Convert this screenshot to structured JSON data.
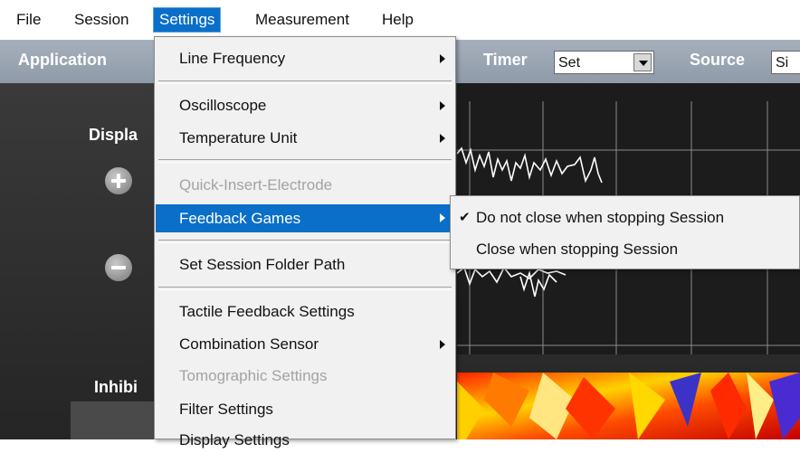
{
  "menubar": {
    "items": [
      {
        "label": "File"
      },
      {
        "label": "Session"
      },
      {
        "label": "Settings"
      },
      {
        "label": "Measurement"
      },
      {
        "label": "Help"
      }
    ]
  },
  "toolbar": {
    "application_label": "Application",
    "timer_label": "Timer",
    "timer_value": "Set",
    "source_label": "Source",
    "source_value": "Si"
  },
  "left_panel": {
    "display_label": "Displa",
    "inhibit_label": "Inhibi"
  },
  "settings_menu": {
    "items": [
      {
        "label": "Line Frequency",
        "submenu": true,
        "enabled": true
      },
      {
        "label": "Oscilloscope",
        "submenu": true,
        "enabled": true
      },
      {
        "label": "Temperature Unit",
        "submenu": true,
        "enabled": true
      },
      {
        "label": "Quick-Insert-Electrode",
        "submenu": false,
        "enabled": false
      },
      {
        "label": "Feedback Games",
        "submenu": true,
        "enabled": true,
        "highlighted": true
      },
      {
        "label": "Set Session Folder Path",
        "submenu": false,
        "enabled": true
      },
      {
        "label": "Tactile Feedback Settings",
        "submenu": false,
        "enabled": true
      },
      {
        "label": "Combination Sensor",
        "submenu": true,
        "enabled": true
      },
      {
        "label": "Tomographic Settings",
        "submenu": false,
        "enabled": false
      },
      {
        "label": "Filter Settings",
        "submenu": false,
        "enabled": true
      },
      {
        "label": "Display Settings",
        "submenu": false,
        "enabled": true
      }
    ]
  },
  "feedback_submenu": {
    "items": [
      {
        "label": "Do not close when stopping Session",
        "checked": true
      },
      {
        "label": "Close when stopping Session",
        "checked": false
      }
    ],
    "check_glyph": "✔"
  },
  "colors": {
    "accent": "#0a6fc8",
    "toolbar": "#98a3b0",
    "background_dark": "#2e2e2e"
  }
}
